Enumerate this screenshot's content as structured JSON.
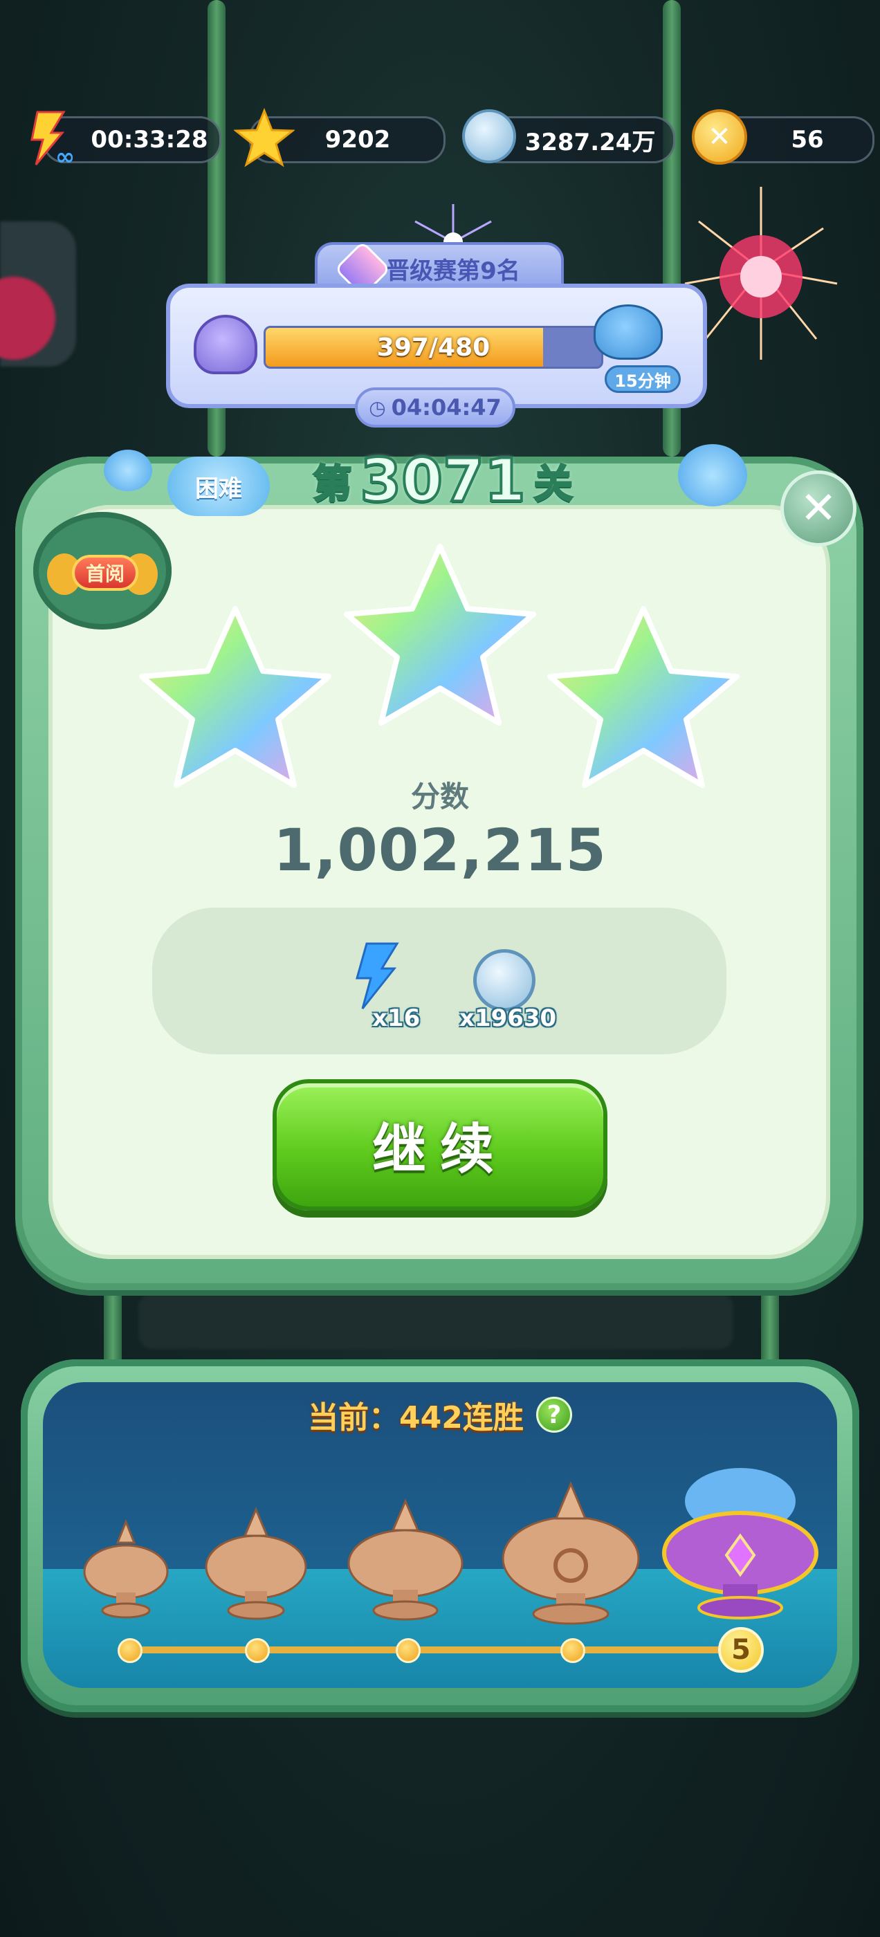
{
  "topbar": {
    "energy_timer": "00:33:28",
    "stars": "9202",
    "coins": "3287.24万",
    "gold": "56"
  },
  "ranking": {
    "title": "晋级赛第9名",
    "progress_text": "397/480",
    "progress_fraction": 0.827,
    "bonus_time": "15分钟",
    "countdown": "04:04:47"
  },
  "level": {
    "prefix": "第",
    "number": "3071",
    "suffix": "关",
    "difficulty": "困难",
    "first_clear_badge": "首阅",
    "stars_earned": 3,
    "score_label": "分数",
    "score_value": "1,002,215"
  },
  "rewards": [
    {
      "icon": "lightning-icon",
      "quantity": "x16"
    },
    {
      "icon": "coin-icon",
      "quantity": "x19630"
    }
  ],
  "buttons": {
    "continue": "继续",
    "close": "✕"
  },
  "streak": {
    "title": "当前：442连胜",
    "help": "?",
    "final_milestone": "5"
  },
  "colors": {
    "accent_green": "#5fcb1e",
    "panel_green": "#6fbd8c",
    "score_text": "#4d6b6e",
    "streak_title": "#ffd15a"
  }
}
